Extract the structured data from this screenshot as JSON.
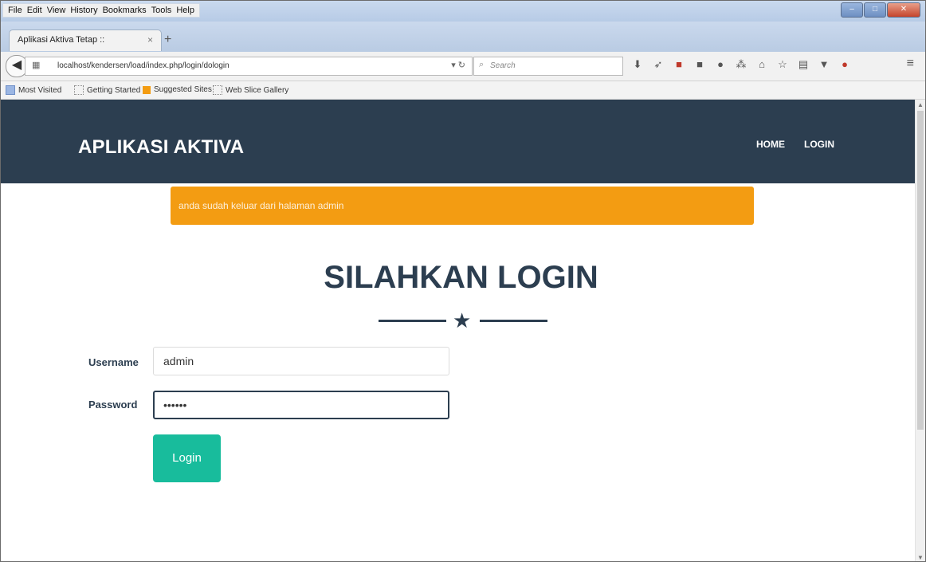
{
  "browser": {
    "menu": [
      "File",
      "Edit",
      "View",
      "History",
      "Bookmarks",
      "Tools",
      "Help"
    ],
    "tab_title": "Aplikasi Aktiva Tetap ::",
    "tab_close": "×",
    "new_tab": "+",
    "url": "localhost/kendersen/load/index.php/login/dologin",
    "search_placeholder": "Search",
    "bookmarks": [
      "Most Visited",
      "Getting Started",
      "Suggested Sites",
      "Web Slice Gallery"
    ]
  },
  "site": {
    "brand": "APLIKASI AKTIVA",
    "nav": [
      "HOME",
      "LOGIN"
    ]
  },
  "alert": {
    "message": "anda sudah keluar dari halaman admin",
    "color": "#f39c12"
  },
  "login": {
    "title": "SILAHKAN LOGIN",
    "username_label": "Username",
    "username_value": "admin",
    "password_label": "Password",
    "password_value": "••••••",
    "button_label": "Login",
    "button_color": "#18bc9c"
  },
  "theme": {
    "primary": "#2c3e50"
  }
}
